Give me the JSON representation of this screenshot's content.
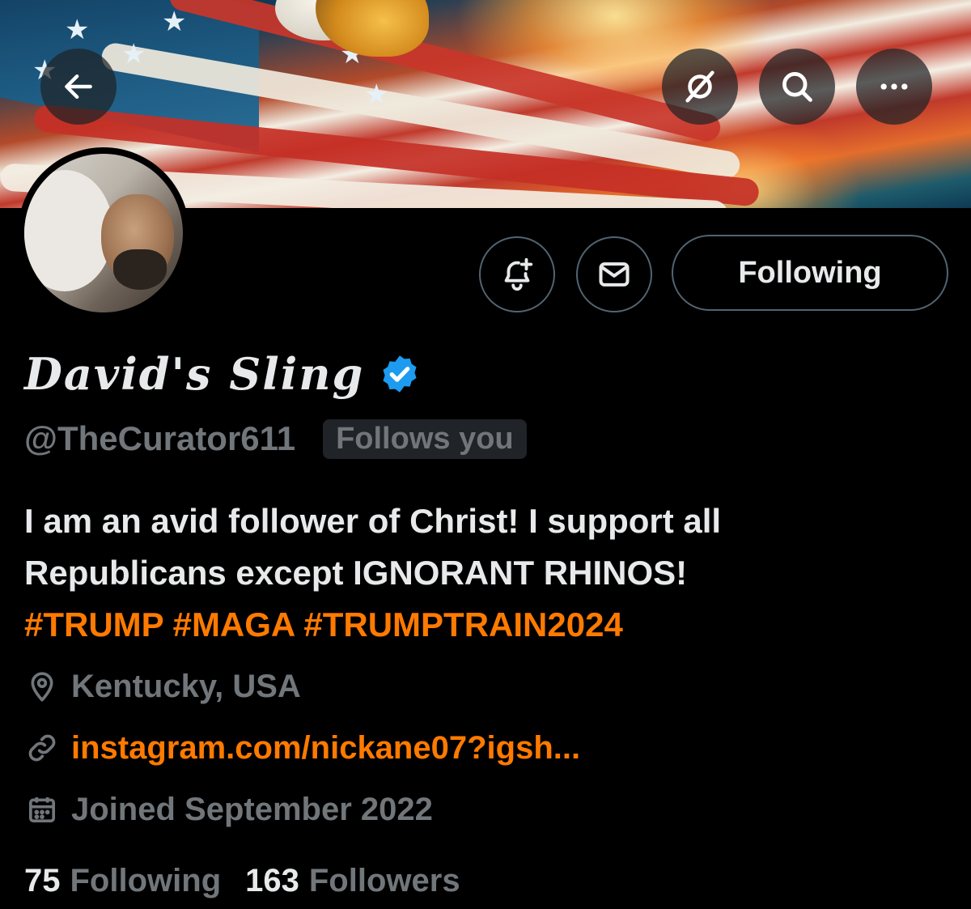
{
  "profile": {
    "display_name": "David's Sling",
    "handle": "@TheCurator611",
    "follows_you_label": "Follows you",
    "verified": true,
    "bio": {
      "line1": "I am an avid follower of Christ! I support all",
      "line2": "Republicans except IGNORANT RHINOS!",
      "hashtags": "#TRUMP #MAGA #TRUMPTRAIN2024"
    },
    "location": "Kentucky, USA",
    "website": "instagram.com/nickane07?igsh...",
    "joined": "Joined September 2022",
    "following_count": "75",
    "following_label": "Following",
    "followers_count": "163",
    "followers_label": "Followers"
  },
  "actions": {
    "follow_state_label": "Following"
  },
  "icons": {
    "back": "arrow-left-icon",
    "grok": "slash-circle-icon",
    "search": "search-icon",
    "more": "more-dots-icon",
    "notifications": "bell-plus-icon",
    "message": "envelope-icon",
    "verified": "verified-badge-icon",
    "location": "location-pin-icon",
    "link": "link-icon",
    "calendar": "calendar-icon"
  },
  "colors": {
    "background": "#000000",
    "text": "#e7e9ea",
    "secondary_text": "#71767b",
    "accent": "#ff7a00",
    "verified": "#1d9bf0",
    "border": "#536471"
  }
}
